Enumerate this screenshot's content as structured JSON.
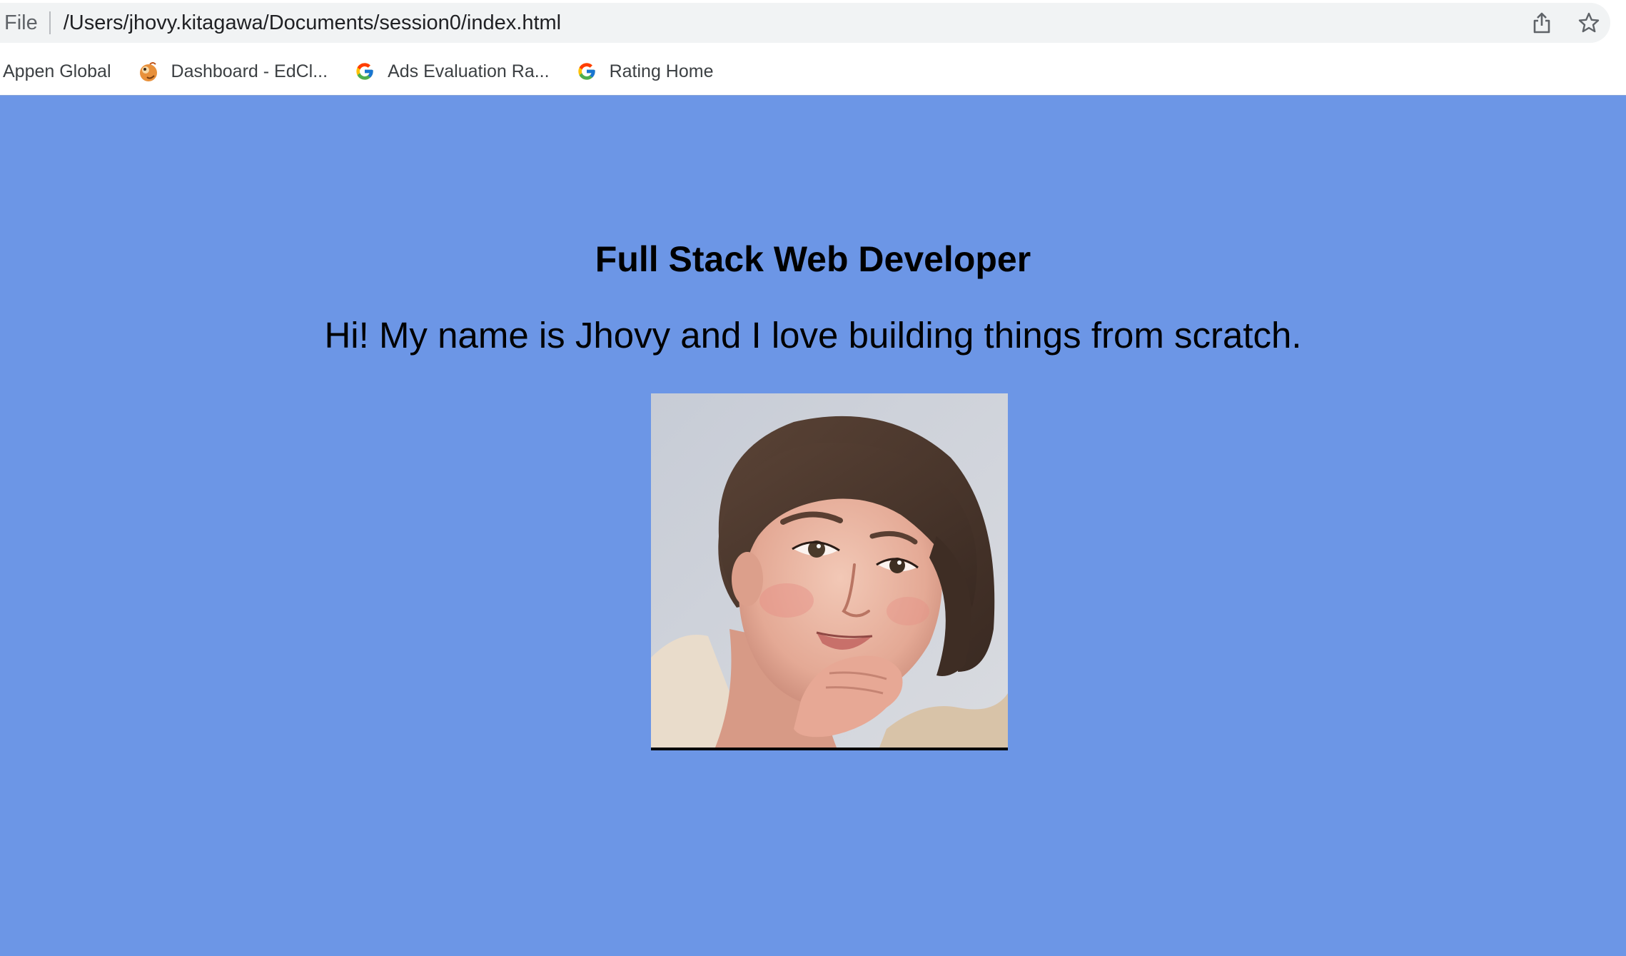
{
  "browser": {
    "scheme_label": "File",
    "url": "/Users/jhovy.kitagawa/Documents/session0/index.html",
    "actions": {
      "share_icon": "share-icon",
      "bookmark_icon": "star-icon"
    }
  },
  "bookmarks": [
    {
      "label": "Appen Global",
      "icon": ""
    },
    {
      "label": "Dashboard - EdCl...",
      "icon": "dashboard-favicon"
    },
    {
      "label": "Ads Evaluation Ra...",
      "icon": "google-g-icon"
    },
    {
      "label": "Rating Home",
      "icon": "google-g-icon"
    }
  ],
  "page": {
    "background": "#6c96e6",
    "headline": "Full Stack Web Developer",
    "intro": "Hi! My name is Jhovy and I love building things from scratch.",
    "photo_icon": "portrait-illustration"
  }
}
